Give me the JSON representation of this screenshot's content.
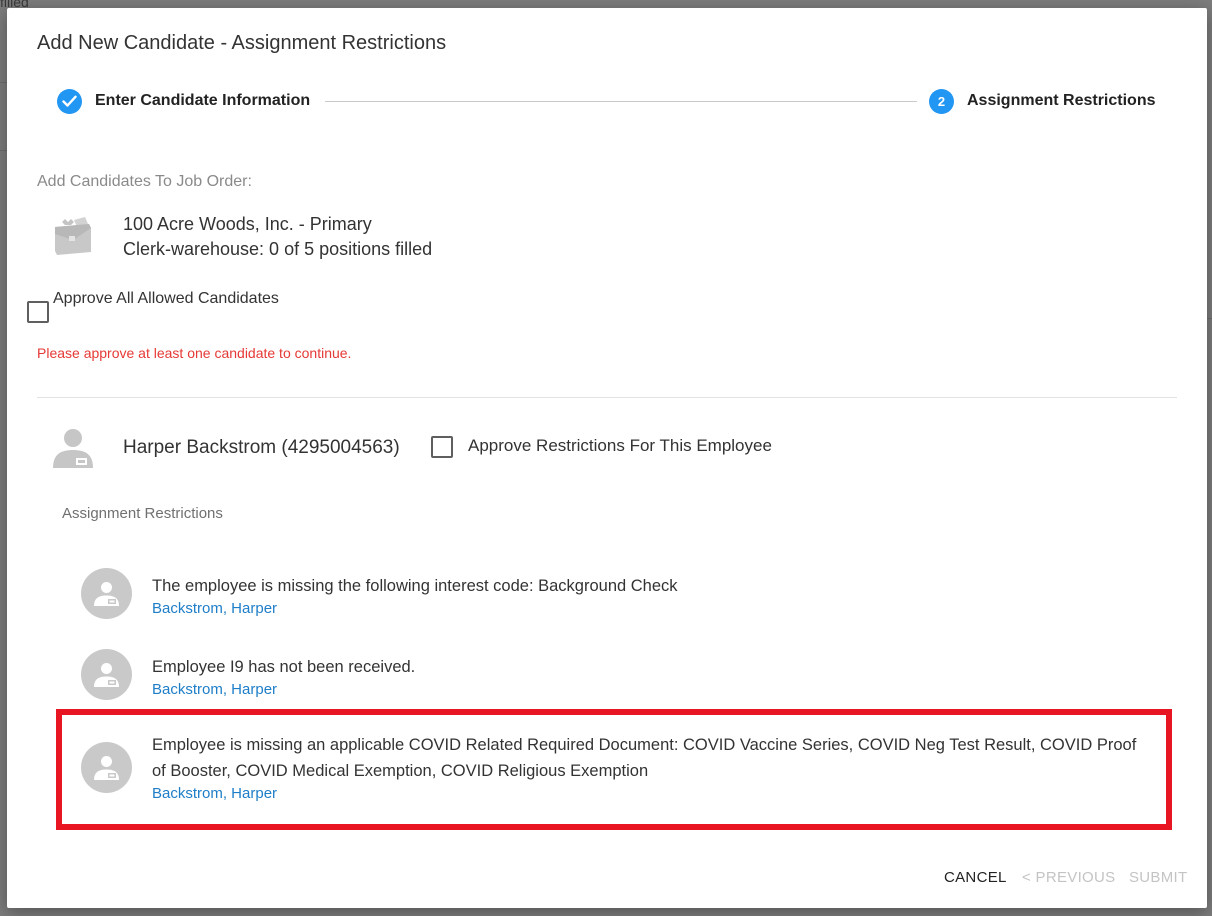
{
  "backdrop": {
    "text": "filled"
  },
  "dialog": {
    "title": "Add New Candidate - Assignment Restrictions",
    "stepper": {
      "step1_label": "Enter Candidate Information",
      "step2_number": "2",
      "step2_label": "Assignment Restrictions"
    },
    "section_label": "Add Candidates To Job Order:",
    "job": {
      "company": "100 Acre Woods, Inc. - Primary",
      "position": "Clerk-warehouse: 0 of 5 positions filled"
    },
    "approve_all_label": "Approve All Allowed Candidates",
    "error_text": "Please approve at least one candidate to continue.",
    "employee": {
      "name": "Harper Backstrom (4295004563)",
      "approve_label": "Approve Restrictions For This Employee"
    },
    "restrictions_header": "Assignment Restrictions",
    "restrictions": [
      {
        "text": "The employee is missing the following interest code: Background Check",
        "link": "Backstrom, Harper"
      },
      {
        "text": "Employee I9 has not been received.",
        "link": "Backstrom, Harper"
      },
      {
        "text": "Employee is missing an applicable COVID Related Required Document: COVID Vaccine Series, COVID Neg Test Result, COVID Proof of Booster, COVID Medical Exemption, COVID Religious Exemption",
        "link": "Backstrom, Harper"
      }
    ],
    "footer": {
      "cancel": "CANCEL",
      "previous": "< PREVIOUS",
      "submit": "SUBMIT"
    },
    "colors": {
      "accent": "#2196f3",
      "error": "#e53935",
      "link": "#1e7ec8",
      "highlight": "#e81523"
    }
  }
}
